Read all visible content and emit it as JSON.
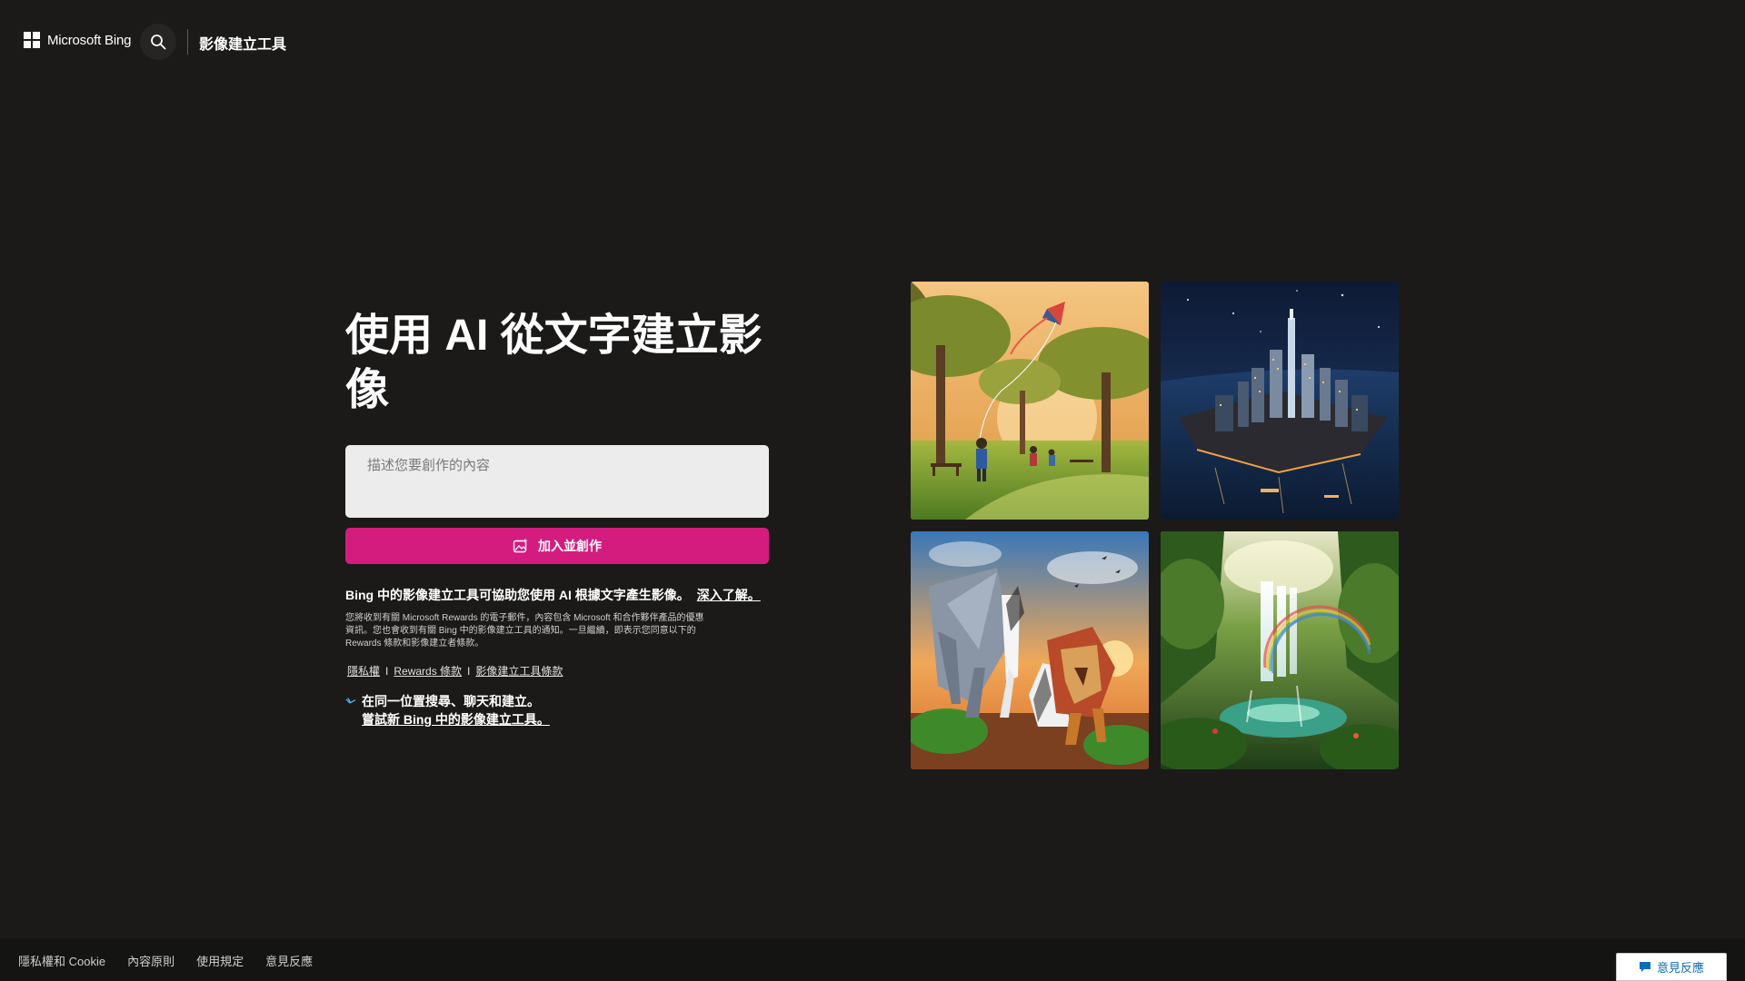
{
  "header": {
    "brand_label": "Microsoft Bing",
    "title": "影像建立工具"
  },
  "hero": {
    "title": "使用 AI 從文字建立影像",
    "prompt_placeholder": "描述您要創作的內容",
    "create_button_label": "加入並創作",
    "description": "Bing 中的影像建立工具可協助您使用 AI 根據文字產生影像。",
    "learn_more_label": "深入了解。",
    "fineprint": "您將收到有關 Microsoft Rewards 的電子郵件，內容包含 Microsoft 和合作夥伴產品的優惠資訊。您也會收到有關 Bing 中的影像建立工具的通知。一旦繼續，即表示您同意以下的 Rewards 條款和影像建立者條款。",
    "legal_links": [
      "隱私權",
      "Rewards 條款",
      "影像建立工具條款"
    ],
    "legal_separator": "I",
    "promo_line1": "在同一位置搜尋、聊天和建立。",
    "promo_link": "嘗試新 Bing 中的影像建立工具。"
  },
  "gallery": [
    {
      "name": "kite-park-image",
      "icon": "kite-park-illustration"
    },
    {
      "name": "night-city-image",
      "icon": "night-city-illustration"
    },
    {
      "name": "origami-animals-image",
      "icon": "origami-animals-illustration"
    },
    {
      "name": "waterfall-rainbow-image",
      "icon": "waterfall-illustration"
    }
  ],
  "footer": {
    "links": [
      "隱私權和 Cookie",
      "內容原則",
      "使用規定",
      "意見反應"
    ],
    "feedback_button_label": "意見反應"
  },
  "colors": {
    "background": "#1b1a19",
    "accent": "#d41c7f",
    "footer": "#141413"
  }
}
